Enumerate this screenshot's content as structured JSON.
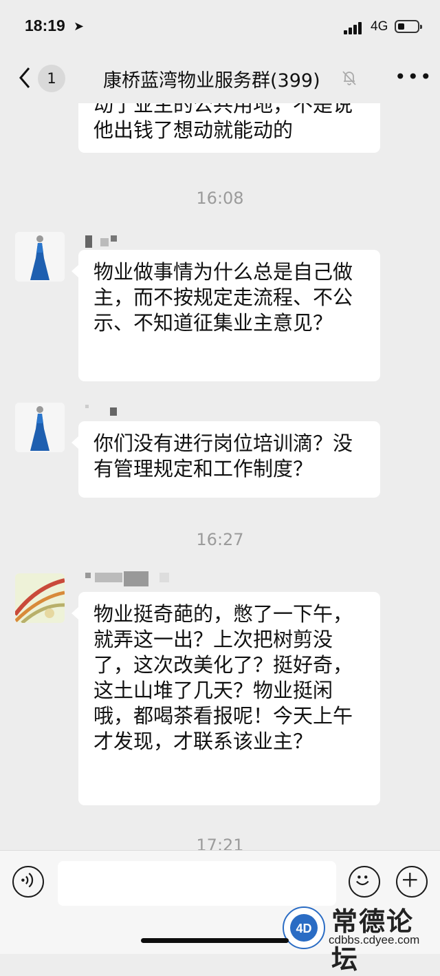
{
  "status_bar": {
    "time": "18:19",
    "network": "4G"
  },
  "nav": {
    "back_badge": "1",
    "title": "康桥蓝湾物业服务群(399)"
  },
  "messages": [
    {
      "type": "partial_text",
      "text": "动了业主的公共用地，不是说他出钱了想动就能动的"
    },
    {
      "type": "time",
      "text": "16:08"
    },
    {
      "type": "text",
      "avatar": "avatar-blue-dress",
      "text": "物业做事情为什么总是自己做主，而不按规定走流程、不公示、不知道征集业主意见？"
    },
    {
      "type": "text",
      "avatar": "avatar-blue-dress",
      "text": "你们没有进行岗位培训滴？没有管理规定和工作制度？"
    },
    {
      "type": "time",
      "text": "16:27"
    },
    {
      "type": "text",
      "avatar": "avatar-koi",
      "text": "物业挺奇葩的，憋了一下午，就弄这一出？上次把树剪没了，这次改美化了？挺好奇，这土山堆了几天？物业挺闲哦，都喝茶看报呢！今天上午才发现，才联系该业主？"
    },
    {
      "type": "time",
      "text": "17:21"
    }
  ],
  "watermark": {
    "title": "常德论坛",
    "url": "cdbbs.cdyee.com"
  },
  "colors": {
    "background": "#ededed",
    "bubble": "#ffffff",
    "timestamp": "#9b9b9b"
  },
  "icons": [
    "location-arrow-icon",
    "signal-icon",
    "battery-icon",
    "back-chevron-icon",
    "mute-bell-icon",
    "more-icon",
    "voice-icon",
    "emoji-icon",
    "plus-icon"
  ]
}
